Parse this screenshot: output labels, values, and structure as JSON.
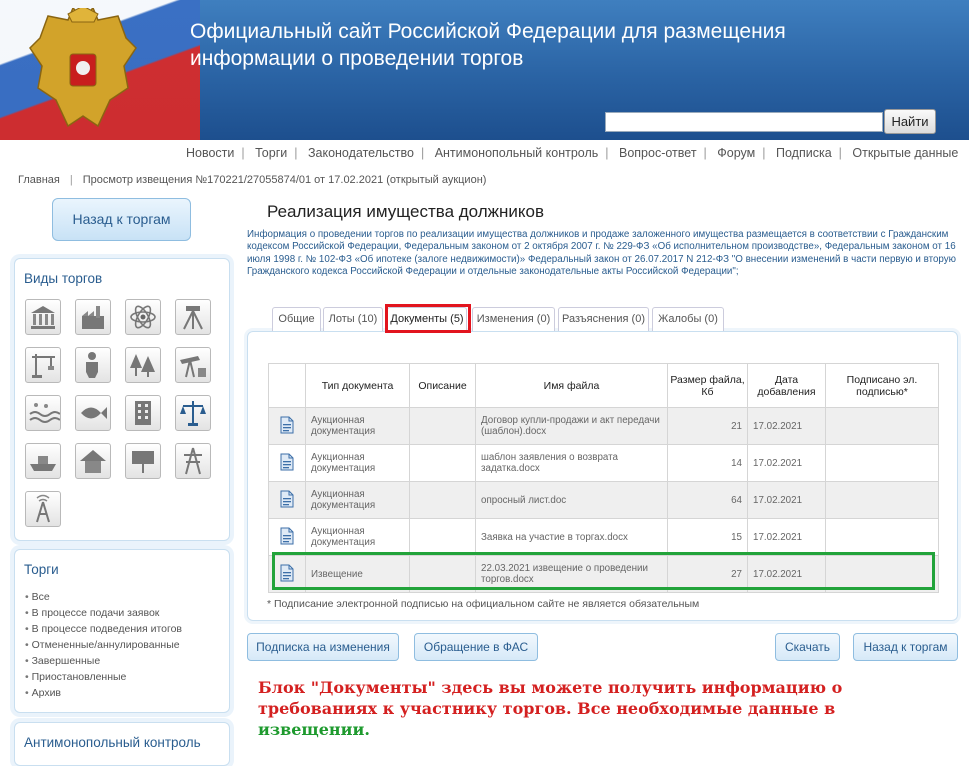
{
  "header": {
    "title": "Официальный сайт Российской Федерации для размещения информации о проведении торгов",
    "search_placeholder": "",
    "search_button": "Найти"
  },
  "topnav": [
    "Новости",
    "Торги",
    "Законодательство",
    "Антимонопольный контроль",
    "Вопрос-ответ",
    "Форум",
    "Подписка",
    "Открытые данные"
  ],
  "breadcrumb": {
    "home": "Главная",
    "current": "Просмотр извещения №170221/27055874/01 от 17.02.2021 (открытый аукцион)"
  },
  "sidebar": {
    "back_button": "Назад к торгам",
    "vidy_title": "Виды торгов",
    "vidy_icons": [
      "bank-icon",
      "factory-icon",
      "atom-icon",
      "geodesy-icon",
      "crane-icon",
      "worker-icon",
      "forest-icon",
      "oil-pump-icon",
      "water-icon",
      "fish-icon",
      "building-icon",
      "justice-icon",
      "ship-icon",
      "house-icon",
      "billboard-icon",
      "power-line-icon",
      "radio-tower-icon"
    ],
    "torgi_title": "Торги",
    "torgi_items": [
      "Все",
      "В процессе подачи заявок",
      "В процессе подведения итогов",
      "Отмененные/аннулированные",
      "Завершенные",
      "Приостановленные",
      "Архив"
    ],
    "antimon_title": "Антимонопольный контроль"
  },
  "main": {
    "title": "Реализация имущества должников",
    "info": "Информация о проведении торгов по реализации имущества должников и продаже заложенного имущества размещается в соответствии с Гражданским кодексом Российской Федерации, Федеральным законом от 2 октября 2007 г. № 229-ФЗ «Об исполнительном производстве», Федеральным законом от 16 июля 1998 г. № 102-ФЗ «Об ипотеке (залоге недвижимости)» Федеральный закон от 26.07.2017 N 212-ФЗ \"О внесении изменений в части первую и вторую Гражданского кодекса Российской Федерации и отдельные законодательные акты Российской Федерации\";",
    "tabs": [
      "Общие",
      "Лоты (10)",
      "Документы (5)",
      "Изменения (0)",
      "Разъяснения (0)",
      "Жалобы (0)"
    ],
    "active_tab": "Документы (5)",
    "table": {
      "headers": [
        "Тип документа",
        "Описание",
        "Имя файла",
        "Размер файла, Кб",
        "Дата добавления",
        "Подписано эл. подписью*"
      ],
      "rows": [
        {
          "type": "Аукционная документация",
          "desc": "",
          "file": "Договор купли-продажи и акт передачи (шаблон).docx",
          "size": "21",
          "date": "17.02.2021",
          "signed": ""
        },
        {
          "type": "Аукционная документация",
          "desc": "",
          "file": "шаблон заявления о возврата задатка.docx",
          "size": "14",
          "date": "17.02.2021",
          "signed": ""
        },
        {
          "type": "Аукционная документация",
          "desc": "",
          "file": "опросный лист.doc",
          "size": "64",
          "date": "17.02.2021",
          "signed": ""
        },
        {
          "type": "Аукционная документация",
          "desc": "",
          "file": "Заявка на участие в торгах.docx",
          "size": "15",
          "date": "17.02.2021",
          "signed": ""
        },
        {
          "type": "Извещение",
          "desc": "",
          "file": "22.03.2021 извещение о проведении торгов.docx",
          "size": "27",
          "date": "17.02.2021",
          "signed": ""
        }
      ]
    },
    "note": "* Подписание электронной подписью на официальном сайте не является обязательным",
    "buttons": {
      "subscribe": "Подписка на изменения",
      "fas": "Обращение в ФАС",
      "download": "Скачать",
      "back": "Назад к торгам"
    },
    "annotation_red": "Блок \"Документы\" здесь вы можете получить информацию о требованиях к участнику торгов. Все необходимые данные в",
    "annotation_green": "извещении."
  },
  "colors": {
    "header_blue": "#2a63a4",
    "link_blue": "#2a5d8f",
    "highlight_red": "#e2141e",
    "highlight_green": "#22a33a"
  }
}
